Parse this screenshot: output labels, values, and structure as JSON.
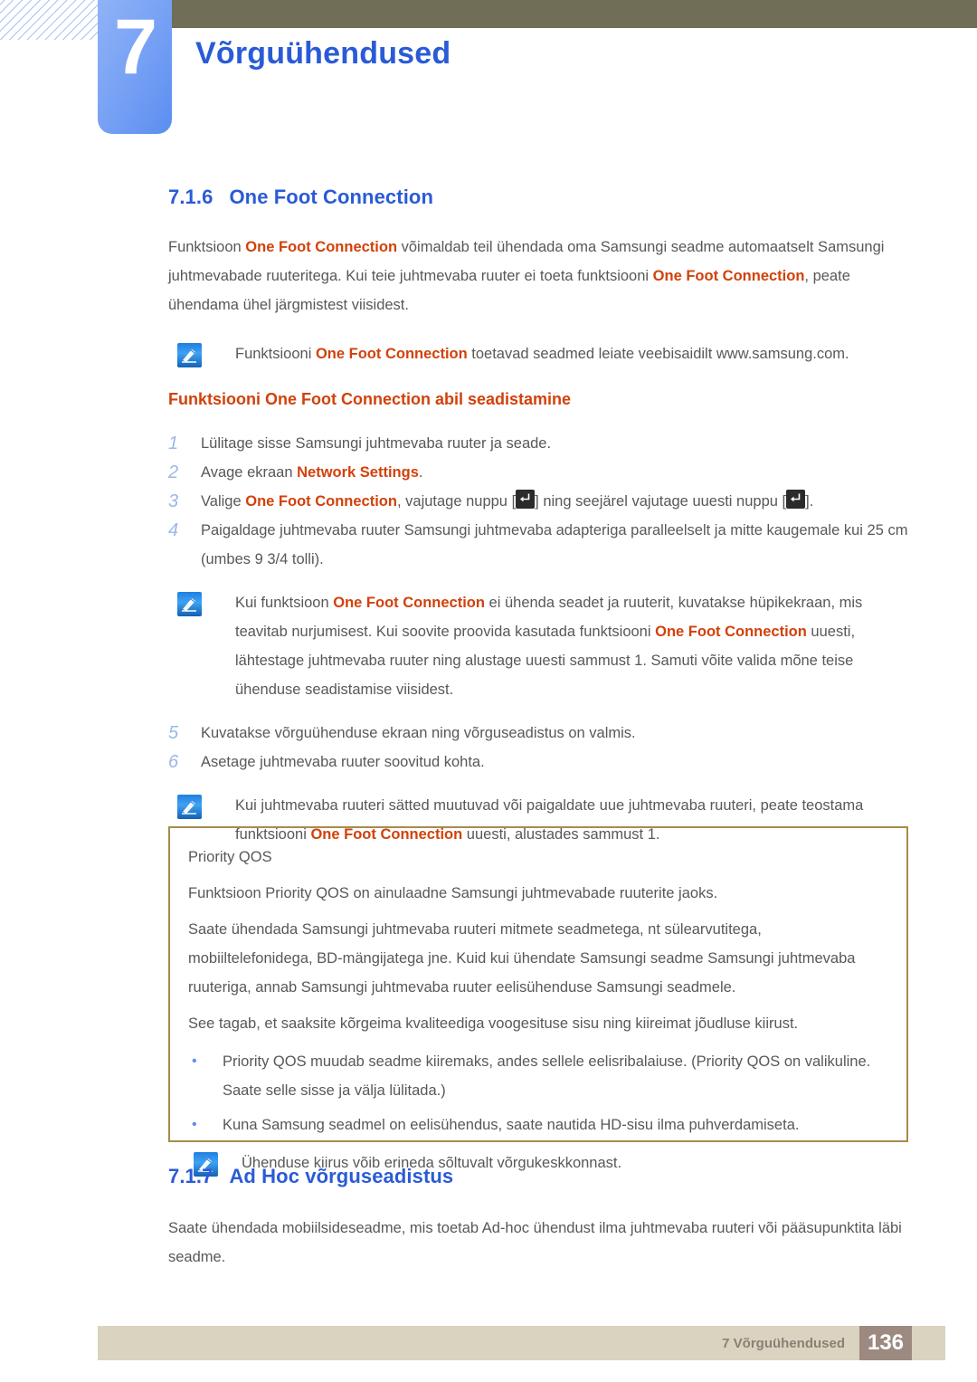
{
  "header": {
    "chapter_number": "7",
    "chapter_title": "Võrguühendused",
    "accent_blue": "#2a5bd7",
    "tab_blue": "#7aa3f5",
    "olive": "#706e56"
  },
  "section_716": {
    "number": "7.1.6",
    "title": "One Foot Connection",
    "intro": {
      "p1_a": "Funktsioon ",
      "p1_hl1": "One Foot Connection",
      "p1_b": " võimaldab teil ühendada oma Samsungi seadme automaatselt Samsungi juhtmevabade ruuteritega. Kui teie juhtmevaba ruuter ei toeta funktsiooni ",
      "p1_hl2": "One Foot Connection",
      "p1_c": ", peate ühendama ühel järgmistest viisidest."
    },
    "note1": {
      "icon": "note-pen-icon",
      "a": "Funktsiooni ",
      "hl": "One Foot Connection",
      "b": " toetavad seadmed leiate veebisaidilt www.samsung.com."
    },
    "sub_heading": "Funktsiooni One Foot Connection abil seadistamine",
    "steps": [
      {
        "num": "1",
        "a": "Lülitage sisse Samsungi juhtmevaba ruuter ja seade.",
        "hl": "",
        "b": ""
      },
      {
        "num": "2",
        "a": "Avage ekraan ",
        "hl": "Network Settings",
        "b": "."
      },
      {
        "num": "3",
        "a": "Valige ",
        "hl": "One Foot Connection",
        "b": ", vajutage nuppu [",
        "key1": "enter-key-icon",
        "c": "] ning seejärel vajutage uuesti nuppu [",
        "key2": "enter-key-icon",
        "d": "]."
      },
      {
        "num": "4",
        "a": "Paigaldage juhtmevaba ruuter Samsungi juhtmevaba adapteriga paralleelselt ja mitte kaugemale kui 25 cm (umbes 9 3/4 tolli).",
        "hl": "",
        "b": ""
      }
    ],
    "note2": {
      "icon": "note-pen-icon",
      "a": "Kui funktsioon ",
      "hl1": "One Foot Connection",
      "b": " ei ühenda seadet ja ruuterit, kuvatakse hüpikekraan, mis teavitab nurjumisest. Kui soovite proovida kasutada funktsiooni ",
      "hl2": "One Foot Connection",
      "c": " uuesti, lähtestage juhtmevaba ruuter ning alustage uuesti sammust 1. Samuti võite valida mõne teise ühenduse seadistamise viisidest."
    },
    "steps_cont": [
      {
        "num": "5",
        "a": "Kuvatakse võrguühenduse ekraan ning võrguseadistus on valmis."
      },
      {
        "num": "6",
        "a": "Asetage juhtmevaba ruuter soovitud kohta."
      }
    ],
    "note3": {
      "icon": "note-pen-icon",
      "a": "Kui juhtmevaba ruuteri sätted muutuvad või paigaldate uue juhtmevaba ruuteri, peate teostama funktsiooni ",
      "hl": "One Foot Connection",
      "b": " uuesti, alustades sammust 1."
    }
  },
  "qos_box": {
    "border_color": "#a68b4b",
    "title": "Priority QOS",
    "p1": "Funktsioon Priority QOS on ainulaadne Samsungi juhtmevabade ruuterite jaoks.",
    "p2": "Saate ühendada Samsungi juhtmevaba ruuteri mitmete seadmetega, nt sülearvutitega, mobiiltelefonidega, BD-mängijatega jne. Kuid kui ühendate Samsungi seadme Samsungi juhtmevaba ruuteriga, annab Samsungi juhtmevaba ruuter eelisühenduse Samsungi seadmele.",
    "p3": "See tagab, et saaksite kõrgeima kvaliteediga voogesituse sisu ning kiireimat jõudluse kiirust.",
    "bullets": [
      {
        "dot": "•",
        "text": "Priority QOS muudab seadme kiiremaks, andes sellele eelisribalaiuse. (Priority QOS on valikuline. Saate selle sisse ja välja lülitada.)"
      },
      {
        "dot": "•",
        "text": "Kuna Samsung seadmel on eelisühendus, saate nautida HD-sisu ilma puhverdamiseta."
      }
    ],
    "note": {
      "icon": "note-pen-icon",
      "text": "Ühenduse kiirus võib erineda sõltuvalt võrgukeskkonnast."
    }
  },
  "section_717": {
    "number": "7.1.7",
    "title": "Ad Hoc võrguseadistus",
    "p1": "Saate ühendada mobiilsideseadme, mis toetab Ad-hoc ühendust ilma juhtmevaba ruuteri või pääsupunktita läbi seadme."
  },
  "footer": {
    "text": "7 Võrguühendused",
    "page": "136",
    "bar_color": "#d9d3c0",
    "page_color": "#9c8a80"
  }
}
